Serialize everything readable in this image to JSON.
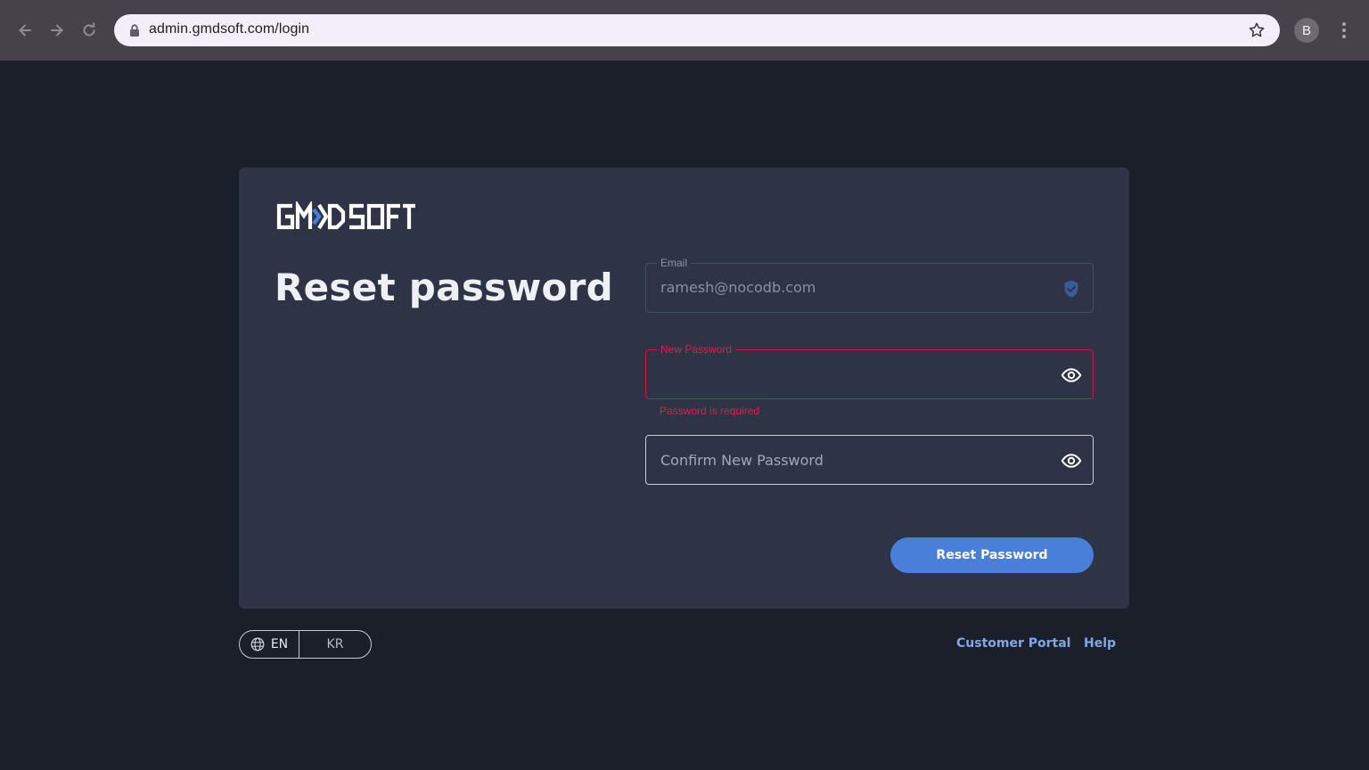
{
  "browser": {
    "url": "admin.gmdsoft.com/login",
    "profile_initial": "B",
    "icons": [
      "back-icon",
      "forward-icon",
      "reload-icon",
      "lock-icon",
      "star-icon",
      "more-icon"
    ]
  },
  "brand": {
    "logo_text": "GMDSOFT",
    "accent_color": "#4a7fd9"
  },
  "page": {
    "title": "Reset password"
  },
  "form": {
    "email": {
      "label": "Email",
      "value": "ramesh@nocodb.com",
      "icon": "verified-shield-icon"
    },
    "new_password": {
      "label": "New Password",
      "value": "",
      "error": "Password is required",
      "icon": "eye-icon"
    },
    "confirm_password": {
      "placeholder": "Confirm New Password",
      "value": "",
      "icon": "eye-icon"
    },
    "submit_label": "Reset Password"
  },
  "footer": {
    "languages": [
      {
        "code": "EN",
        "selected": true
      },
      {
        "code": "KR",
        "selected": false
      }
    ],
    "links": {
      "customer_portal": "Customer Portal",
      "help": "Help"
    }
  },
  "colors": {
    "page_bg": "#1b1f2a",
    "card_bg": "#2d3446",
    "error": "#e01e4a",
    "link": "#7fa8ea"
  }
}
